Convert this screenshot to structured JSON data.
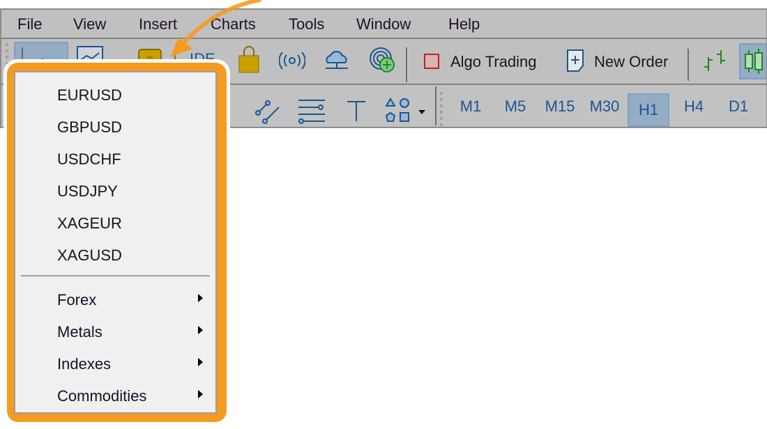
{
  "menubar": {
    "items": [
      "File",
      "View",
      "Insert",
      "Charts",
      "Tools",
      "Window",
      "Help"
    ]
  },
  "toolbar": {
    "ide_label": "IDE",
    "algo_trading_label": "Algo Trading",
    "new_order_label": "New Order",
    "timeframes": [
      "M1",
      "M5",
      "M15",
      "M30",
      "H1",
      "H4",
      "D1"
    ],
    "active_timeframe": "H1"
  },
  "symbols_menu": {
    "symbols": [
      "EURUSD",
      "GBPUSD",
      "USDCHF",
      "USDJPY",
      "XAGEUR",
      "XAGUSD"
    ],
    "groups": [
      "Forex",
      "Metals",
      "Indexes",
      "Commodities"
    ]
  },
  "colors": {
    "highlight_orange": "#f49b22",
    "icon_blue": "#1a5690",
    "active_bg": "#94acc4",
    "green": "#1a8a1a",
    "gold": "#c9a000"
  }
}
